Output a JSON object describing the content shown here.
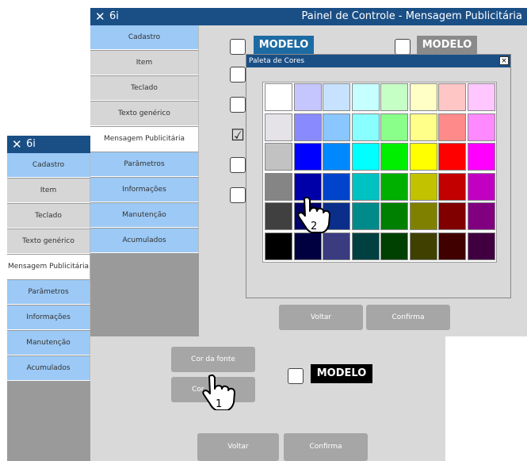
{
  "back_window": {
    "app_label": "6i",
    "menu": [
      {
        "label": "Cadastro",
        "style": "blue"
      },
      {
        "label": "Item",
        "style": "grey"
      },
      {
        "label": "Teclado",
        "style": "grey"
      },
      {
        "label": "Texto genérico",
        "style": "grey"
      },
      {
        "label": "Mensagem Publicitária",
        "style": "white"
      },
      {
        "label": "Parâmetros",
        "style": "blue"
      },
      {
        "label": "Informações",
        "style": "blue"
      },
      {
        "label": "Manutenção",
        "style": "blue"
      },
      {
        "label": "Acumulados",
        "style": "blue"
      }
    ],
    "font_color_button": "Cor da fonte",
    "bg_color_button": "Cor",
    "modelo_label": "MODELO",
    "back_button": "Voltar",
    "confirm_button": "Confirma",
    "hand_step": "1"
  },
  "front_window": {
    "app_label": "6i",
    "title": "Painel de Controle - Mensagem Publicitária",
    "menu": [
      {
        "label": "Cadastro",
        "style": "blue"
      },
      {
        "label": "Item",
        "style": "grey"
      },
      {
        "label": "Teclado",
        "style": "grey"
      },
      {
        "label": "Texto genérico",
        "style": "grey"
      },
      {
        "label": "Mensagem Publicitária",
        "style": "white"
      },
      {
        "label": "Parâmetros",
        "style": "blue"
      },
      {
        "label": "Informações",
        "style": "blue"
      },
      {
        "label": "Manutenção",
        "style": "blue"
      },
      {
        "label": "Acumulados",
        "style": "blue"
      }
    ],
    "modelo_blue_label": "MODELO",
    "modelo_grey_label": "MODELO",
    "check_mark": "☑",
    "back_button": "Voltar",
    "confirm_button": "Confirma",
    "hand_step": "2"
  },
  "palette_dialog": {
    "title": "Paleta de Cores",
    "close_label": "×",
    "colors": [
      [
        "#ffffff",
        "#c6c6ff",
        "#c6e2ff",
        "#c6ffff",
        "#c6ffc6",
        "#ffffc6",
        "#ffc6c6",
        "#ffc6ff"
      ],
      [
        "#e6e3e8",
        "#8a8aff",
        "#8ac6ff",
        "#8affff",
        "#8aff8a",
        "#ffff8a",
        "#ff8a8a",
        "#ff8aff"
      ],
      [
        "#c2c2c2",
        "#0000ff",
        "#0088ff",
        "#00ffff",
        "#00ee00",
        "#ffff00",
        "#ff0000",
        "#ff00ff"
      ],
      [
        "#858585",
        "#0000a8",
        "#0044cc",
        "#00c2c2",
        "#00b000",
        "#c2c200",
        "#c20000",
        "#c200c2"
      ],
      [
        "#404040",
        "#000066",
        "#0a2e8a",
        "#008a8a",
        "#008000",
        "#808000",
        "#800000",
        "#800080"
      ],
      [
        "#000000",
        "#000040",
        "#3b3b80",
        "#004040",
        "#004000",
        "#404000",
        "#400000",
        "#400040"
      ]
    ]
  },
  "colors": {
    "titlebar": "#1a4f86",
    "modelo_blue_bg": "#1d6ba3",
    "modelo_grey_bg": "#8a8a8a",
    "modelo_black_bg": "#000000",
    "menu_blue": "#9cc9f5"
  }
}
